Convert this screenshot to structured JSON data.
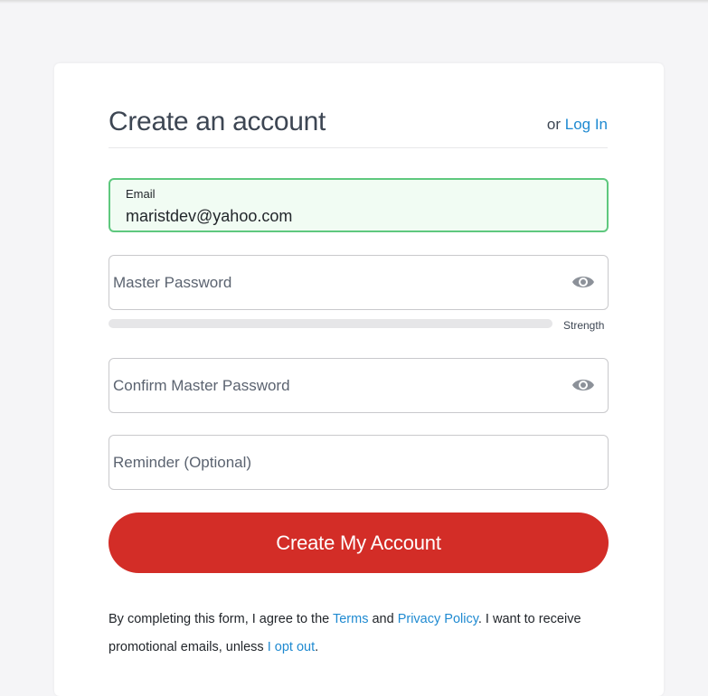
{
  "form": {
    "title": "Create an account",
    "login_prefix": "or",
    "login_link": "Log In",
    "email_label": "Email",
    "email_value": "maristdev@yahoo.com",
    "password_placeholder": "Master Password",
    "strength_label": "Strength",
    "strength_value": 0,
    "confirm_placeholder": "Confirm Master Password",
    "reminder_placeholder": "Reminder (Optional)",
    "submit_label": "Create My Account"
  },
  "legal": {
    "part1": "By completing this form, I agree to the ",
    "terms_link": "Terms",
    "part2": " and ",
    "privacy_link": "Privacy Policy",
    "part3": ". I want to receive promotional emails, unless ",
    "optout_link": "I opt out",
    "part4": "."
  },
  "colors": {
    "accent_red": "#d32d27",
    "link_blue": "#1f8ad1",
    "valid_green": "#5ec87e"
  },
  "icons": {
    "password_toggle": "eye-icon",
    "confirm_toggle": "eye-icon"
  }
}
